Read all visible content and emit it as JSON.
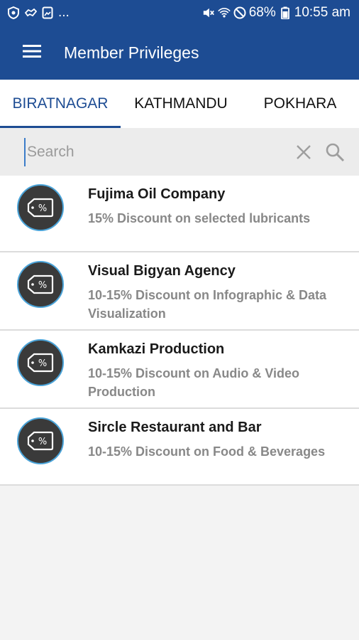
{
  "status_bar": {
    "notif_more": "...",
    "battery_percent": "68%",
    "time": "10:55 am",
    "icons_left": [
      "shield-icon",
      "handshake-icon",
      "gallery-icon"
    ],
    "icons_right": [
      "mute-icon",
      "wifi-icon",
      "do-not-disturb-icon",
      "battery-icon"
    ]
  },
  "app_bar": {
    "title": "Member Privileges",
    "menu_icon": "hamburger-menu-icon"
  },
  "tabs": [
    {
      "label": "BIRATNAGAR",
      "active": true
    },
    {
      "label": "KATHMANDU",
      "active": false
    },
    {
      "label": "POKHARA",
      "active": false
    }
  ],
  "search": {
    "placeholder": "Search",
    "value": "",
    "clear_icon": "close-icon",
    "search_icon": "search-icon"
  },
  "items": [
    {
      "title": "Fujima Oil Company",
      "description": "15% Discount on selected lubricants",
      "icon": "discount-tag-icon"
    },
    {
      "title": "Visual Bigyan Agency",
      "description": "10-15% Discount on Infographic & Data Visualization",
      "icon": "discount-tag-icon"
    },
    {
      "title": "Kamkazi Production",
      "description": "10-15% Discount on Audio & Video Production",
      "icon": "discount-tag-icon"
    },
    {
      "title": "Sircle Restaurant and Bar",
      "description": "10-15% Discount on Food & Beverages",
      "icon": "discount-tag-icon"
    }
  ],
  "colors": {
    "primary": "#1d4c93",
    "icon_ring": "#4aa3d8",
    "icon_bg": "#3a3a3a"
  }
}
